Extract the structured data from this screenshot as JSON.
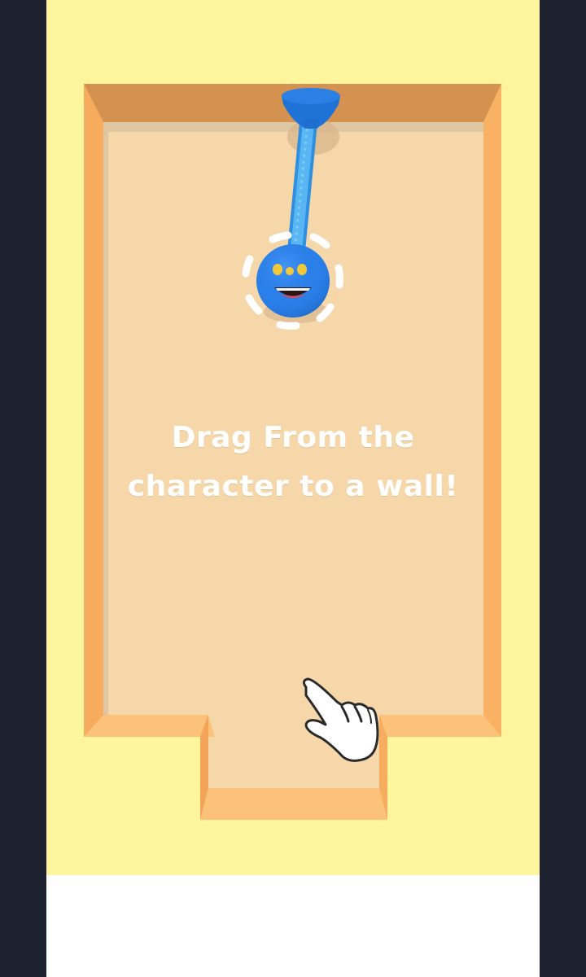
{
  "instruction": {
    "line1": "Drag From the",
    "line2": "character to a wall!"
  },
  "colors": {
    "side_bars": "#1e2130",
    "background": "#fff59d",
    "floor": "#f5d7a9",
    "wall_top": "#d4914f",
    "wall_side": "#fbb566",
    "character": "#2a7fe8",
    "rope": "#46a8ef",
    "eyes": "#f2c938"
  },
  "icons": {
    "character": "blue-ball-character-icon",
    "anchor": "suction-cup-anchor-icon",
    "hand": "pointing-hand-icon"
  }
}
